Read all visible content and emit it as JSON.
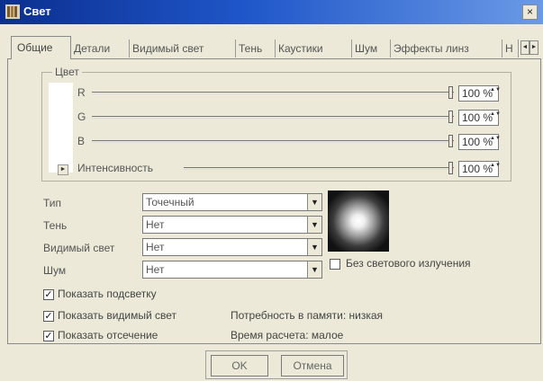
{
  "window": {
    "title": "Свет",
    "close_glyph": "×"
  },
  "tabs": [
    "Общие",
    "Детали",
    "Видимый свет",
    "Тень",
    "Каустики",
    "Шум",
    "Эффекты линз",
    "Н"
  ],
  "tab_scroll": {
    "left": "◄",
    "right": "►"
  },
  "color_group": {
    "legend": "Цвет",
    "expand_glyph": "►",
    "channels": [
      {
        "label": "R",
        "value": "100 %"
      },
      {
        "label": "G",
        "value": "100 %"
      },
      {
        "label": "B",
        "value": "100 %"
      },
      {
        "label": "Интенсивность",
        "value": "100 %"
      }
    ],
    "spin_glyph": "▲▼"
  },
  "fields": [
    {
      "label": "Тип",
      "value": "Точечный"
    },
    {
      "label": "Тень",
      "value": "Нет"
    },
    {
      "label": "Видимый свет",
      "value": "Нет"
    },
    {
      "label": "Шум",
      "value": "Нет"
    }
  ],
  "dropdown_glyph": "▼",
  "no_emission": {
    "label": "Без светового излучения",
    "checked": false
  },
  "checkboxes": [
    {
      "label": "Показать подсветку",
      "checked": true
    },
    {
      "label": "Показать видимый свет",
      "checked": true
    },
    {
      "label": "Показать отсечение",
      "checked": true
    }
  ],
  "check_glyph": "✓",
  "info": {
    "memory": "Потребность в памяти: низкая",
    "calc_time": "Время расчета: малое"
  },
  "buttons": {
    "ok": "OK",
    "cancel": "Отмена"
  },
  "colors": {
    "titlebar_start": "#0b2f8f",
    "titlebar_end": "#6a9ae6",
    "background": "#ece9d8"
  },
  "icons": {
    "app": "light-app-icon",
    "preview": "light-preview-sphere"
  }
}
